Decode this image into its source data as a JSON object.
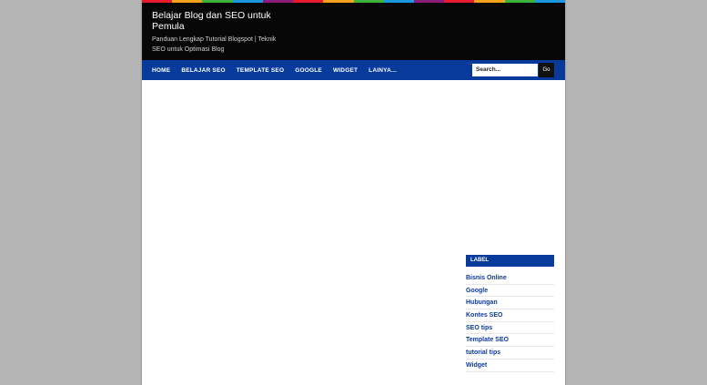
{
  "stripe_colors": [
    "#e8192c",
    "#f7a21b",
    "#3bb33c",
    "#1b98e0",
    "#8c1c7c",
    "#e8192c",
    "#f7a21b",
    "#3bb33c",
    "#1b98e0",
    "#8c1c7c",
    "#e8192c",
    "#f7a21b",
    "#3bb33c",
    "#1b98e0"
  ],
  "header": {
    "title": "Belajar Blog dan SEO untuk Pemula",
    "description": "Panduan Lengkap Tutorial Blogspot | Teknik SEO untuk Optimasi Blog"
  },
  "nav": {
    "items": [
      "HOME",
      "BELAJAR SEO",
      "TEMPLATE SEO",
      "GOOGLE",
      "WIDGET",
      "LAINYA..."
    ]
  },
  "search": {
    "value": "Search...",
    "button_label": "Go"
  },
  "sidebar": {
    "label_title": "LABEL",
    "labels": [
      "Bisnis Online",
      "Google",
      "Hubungan",
      "Kontes SEO",
      "SEO tips",
      "Template SEO",
      "tutorial tips",
      "Widget"
    ]
  },
  "colors": {
    "nav_bg": "#073a9a",
    "header_bg": "#070707",
    "link": "#0b3a9e"
  }
}
